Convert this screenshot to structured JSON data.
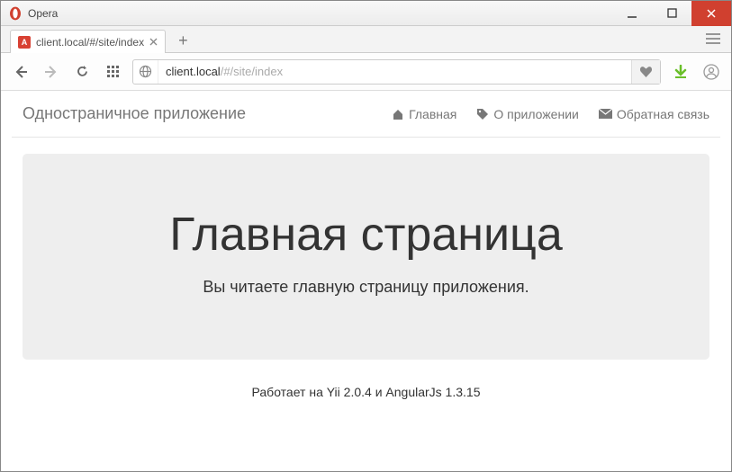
{
  "window": {
    "app_name": "Opera"
  },
  "tabs": {
    "active": {
      "favicon_letter": "A",
      "title": "client.local/#/site/index"
    }
  },
  "addressbar": {
    "url_full": "client.local/#/site/index",
    "url_host": "client.local",
    "url_path": "/#/site/index"
  },
  "navbar": {
    "brand": "Одностраничное приложение",
    "links": {
      "home": "Главная",
      "about": "О приложении",
      "contact": "Обратная связь"
    }
  },
  "content": {
    "heading": "Главная страница",
    "subheading": "Вы читаете главную страницу приложения."
  },
  "footer": {
    "text": "Работает на Yii 2.0.4 и AngularJs 1.3.15"
  }
}
